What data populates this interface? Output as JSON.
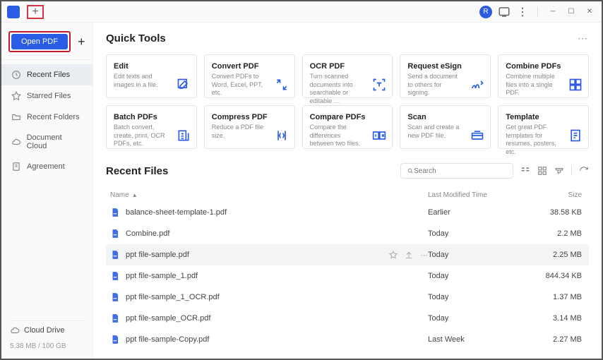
{
  "sidebar": {
    "open_label": "Open PDF",
    "items": [
      {
        "label": "Recent Files",
        "icon": "clock-icon",
        "active": true
      },
      {
        "label": "Starred Files",
        "icon": "star-icon"
      },
      {
        "label": "Recent Folders",
        "icon": "folder-icon"
      },
      {
        "label": "Document Cloud",
        "icon": "cloud-icon"
      },
      {
        "label": "Agreement",
        "icon": "agreement-icon"
      }
    ],
    "cloud_label": "Cloud Drive",
    "storage": "5.38 MB / 100 GB"
  },
  "quick_tools": {
    "title": "Quick Tools",
    "cards": [
      {
        "title": "Edit",
        "desc": "Edit texts and images in a file.",
        "icon": "edit-icon"
      },
      {
        "title": "Convert PDF",
        "desc": "Convert PDFs to Word, Excel, PPT, etc.",
        "icon": "convert-icon"
      },
      {
        "title": "OCR PDF",
        "desc": "Turn scanned documents into searchable or editable …",
        "icon": "ocr-icon"
      },
      {
        "title": "Request eSign",
        "desc": "Send a document to others for signing.",
        "icon": "esign-icon"
      },
      {
        "title": "Combine PDFs",
        "desc": "Combine multiple files into a single PDF.",
        "icon": "combine-icon"
      },
      {
        "title": "Batch PDFs",
        "desc": "Batch convert, create, print, OCR PDFs, etc.",
        "icon": "batch-icon"
      },
      {
        "title": "Compress PDF",
        "desc": "Reduce a PDF file size.",
        "icon": "compress-icon"
      },
      {
        "title": "Compare PDFs",
        "desc": "Compare the differences between two files.",
        "icon": "compare-icon"
      },
      {
        "title": "Scan",
        "desc": "Scan and create a new PDF file.",
        "icon": "scan-icon"
      },
      {
        "title": "Template",
        "desc": "Get great PDF templates for resumes, posters, etc.",
        "icon": "template-icon"
      }
    ]
  },
  "recent": {
    "title": "Recent Files",
    "search_placeholder": "Search",
    "columns": {
      "name": "Name",
      "date": "Last Modified Time",
      "size": "Size"
    },
    "rows": [
      {
        "name": "balance-sheet-template-1.pdf",
        "date": "Earlier",
        "size": "38.58 KB"
      },
      {
        "name": "Combine.pdf",
        "date": "Today",
        "size": "2.2 MB"
      },
      {
        "name": "ppt file-sample.pdf",
        "date": "Today",
        "size": "2.25 MB",
        "hover": true
      },
      {
        "name": "ppt file-sample_1.pdf",
        "date": "Today",
        "size": "844.34 KB"
      },
      {
        "name": "ppt file-sample_1_OCR.pdf",
        "date": "Today",
        "size": "1.37 MB"
      },
      {
        "name": "ppt file-sample_OCR.pdf",
        "date": "Today",
        "size": "3.14 MB"
      },
      {
        "name": "ppt file-sample-Copy.pdf",
        "date": "Last Week",
        "size": "2.27 MB"
      }
    ]
  }
}
